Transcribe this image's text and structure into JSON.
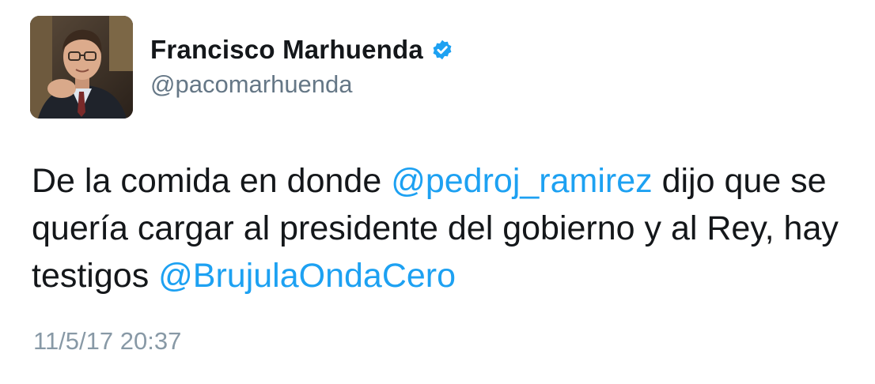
{
  "user": {
    "display_name": "Francisco Marhuenda",
    "handle": "@pacomarhuenda",
    "verified": true,
    "verified_color": "#1da1f2"
  },
  "tweet": {
    "lines": [
      {
        "before": "De la comida en donde ",
        "mention": "@pedroj_ramirez",
        "after": " dijo que se"
      },
      {
        "text": "quería cargar al presidente del gobierno y al Rey, hay"
      },
      {
        "before": "testigos ",
        "mention": "@BrujulaOndaCero"
      }
    ],
    "timestamp": "11/5/17 20:37"
  },
  "colors": {
    "text": "#14171a",
    "link": "#1da1f2",
    "secondary": "#657786",
    "timestamp": "#8899a6"
  }
}
